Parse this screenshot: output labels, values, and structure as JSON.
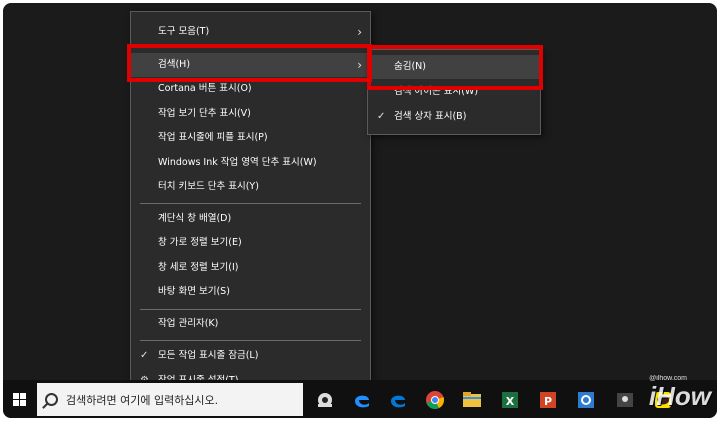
{
  "context_menu": {
    "items": [
      {
        "label": "도구 모음(T)",
        "submenu": true
      },
      {
        "label": "검색(H)",
        "submenu": true,
        "highlighted": true
      },
      {
        "label": "Cortana 버튼 표시(O)"
      },
      {
        "label": "작업 보기 단추 표시(V)"
      },
      {
        "label": "작업 표시줄에 피플 표시(P)"
      },
      {
        "label": "Windows Ink 작업 영역 단추 표시(W)"
      },
      {
        "label": "터치 키보드 단추 표시(Y)"
      },
      {
        "label": "계단식 창 배열(D)"
      },
      {
        "label": "창 가로 정렬 보기(E)"
      },
      {
        "label": "창 세로 정렬 보기(I)"
      },
      {
        "label": "바탕 화면 보기(S)"
      },
      {
        "label": "작업 관리자(K)"
      },
      {
        "label": "모든 작업 표시줄 잠금(L)",
        "checked": true
      },
      {
        "label": "작업 표시줄 설정(T)",
        "icon": "gear-icon"
      }
    ],
    "arrow": "›",
    "check": "✓",
    "gear": "⚙"
  },
  "search_submenu": {
    "items": [
      {
        "label": "숨김(N)",
        "highlighted": true
      },
      {
        "label": "검색 아이콘 표시(W)"
      },
      {
        "label": "검색 상자 표시(B)",
        "checked": true
      }
    ]
  },
  "taskbar": {
    "search_placeholder": "검색하려면 여기에 입력하십시오.",
    "apps": [
      "task-view-icon",
      "edge-legacy-icon",
      "edge-icon",
      "chrome-icon",
      "file-explorer-icon",
      "excel-icon",
      "powerpoint-icon",
      "outlook-icon",
      "people-icon",
      "kakaotalk-icon"
    ]
  },
  "watermark": {
    "brand": "iHow",
    "site": "@ilhow.com"
  },
  "colors": {
    "highlight": "#e00000",
    "menu_bg": "#2b2b2b",
    "hover": "#414141"
  }
}
